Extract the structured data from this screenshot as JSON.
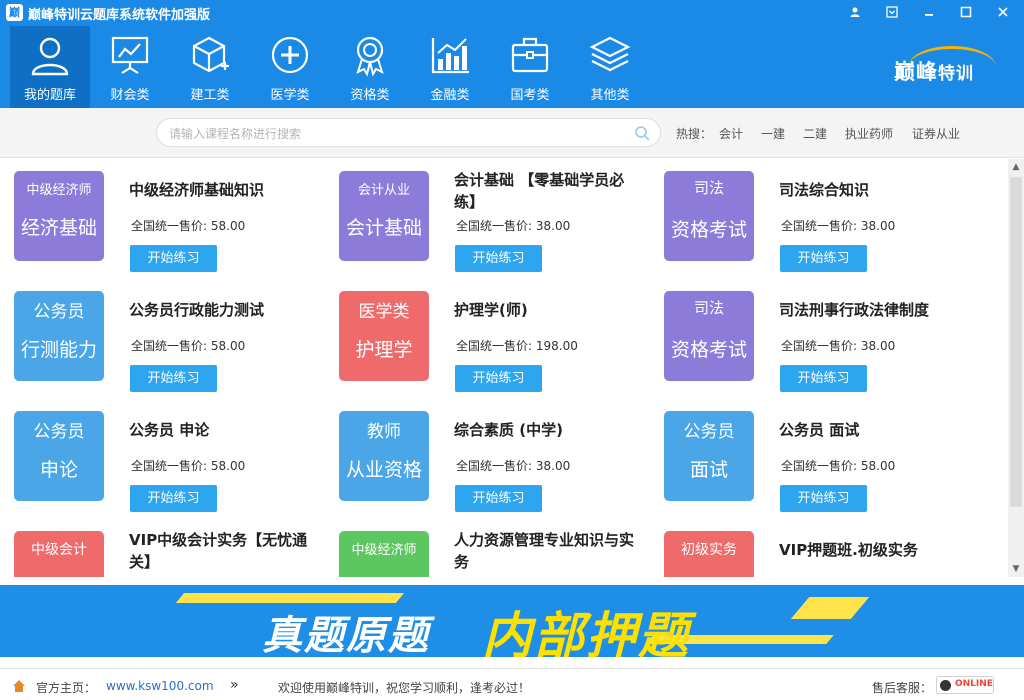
{
  "window": {
    "title": "巅峰特训云题库系统软件加强版",
    "app_icon_glyph": "巅",
    "buttons": [
      "user-icon",
      "settings-icon",
      "minimize-icon",
      "maximize-icon",
      "close-icon"
    ]
  },
  "nav": {
    "items": [
      {
        "label": "我的题库",
        "icon": "user-icon",
        "active": true
      },
      {
        "label": "财会类",
        "icon": "presentation-chart-icon"
      },
      {
        "label": "建工类",
        "icon": "cube-plus-icon"
      },
      {
        "label": "医学类",
        "icon": "medical-cross-icon"
      },
      {
        "label": "资格类",
        "icon": "award-badge-icon"
      },
      {
        "label": "金融类",
        "icon": "bar-chart-icon"
      },
      {
        "label": "国考类",
        "icon": "briefcase-icon"
      },
      {
        "label": "其他类",
        "icon": "layers-icon"
      }
    ],
    "brand": {
      "main": "巅峰",
      "sub": "特训"
    }
  },
  "search": {
    "placeholder": "请输入课程名称进行搜索",
    "hot_label": "热搜：",
    "hot_terms": [
      "会计",
      "一建",
      "二建",
      "执业药师",
      "证券从业"
    ]
  },
  "courses": [
    {
      "thumb_top": "中级经济师",
      "thumb_bottom": "经济基础",
      "color": "#8c7bd9",
      "title": "中级经济师基础知识",
      "price": "全国统一售价: 58.00",
      "button": "开始练习"
    },
    {
      "thumb_top": "会计从业",
      "thumb_bottom": "会计基础",
      "color": "#8c7bd9",
      "title": "会计基础 【零基础学员必练】",
      "price": "全国统一售价: 38.00",
      "button": "开始练习"
    },
    {
      "thumb_top": "司法",
      "thumb_bottom": "资格考试",
      "color": "#8c7bd9",
      "title": "司法综合知识",
      "price": "全国统一售价: 38.00",
      "button": "开始练习"
    },
    {
      "thumb_top": "公务员",
      "thumb_bottom": "行测能力",
      "color": "#4aa6e6",
      "title": "公务员行政能力测试",
      "price": "全国统一售价: 58.00",
      "button": "开始练习"
    },
    {
      "thumb_top": "医学类",
      "thumb_bottom": "护理学",
      "color": "#ef6b6b",
      "title": "护理学(师)",
      "price": "全国统一售价: 198.00",
      "button": "开始练习"
    },
    {
      "thumb_top": "司法",
      "thumb_bottom": "资格考试",
      "color": "#8c7bd9",
      "title": "司法刑事行政法律制度",
      "price": "全国统一售价: 38.00",
      "button": "开始练习"
    },
    {
      "thumb_top": "公务员",
      "thumb_bottom": "申论",
      "color": "#4aa6e6",
      "title": "公务员 申论",
      "price": "全国统一售价: 58.00",
      "button": "开始练习"
    },
    {
      "thumb_top": "教师",
      "thumb_bottom": "从业资格",
      "color": "#4aa6e6",
      "title": "综合素质 (中学)",
      "price": "全国统一售价: 38.00",
      "button": "开始练习"
    },
    {
      "thumb_top": "公务员",
      "thumb_bottom": "面试",
      "color": "#4aa6e6",
      "title": "公务员 面试",
      "price": "全国统一售价: 58.00",
      "button": "开始练习"
    },
    {
      "thumb_top": "中级会计",
      "thumb_bottom": "",
      "color": "#ef6b6b",
      "title": "VIP中级会计实务【无忧通关】",
      "price": "",
      "button": ""
    },
    {
      "thumb_top": "中级经济师",
      "thumb_bottom": "",
      "color": "#5cc760",
      "title": "人力资源管理专业知识与实务",
      "price": "",
      "button": ""
    },
    {
      "thumb_top": "初级实务",
      "thumb_bottom": "",
      "color": "#ef6b6b",
      "title": "VIP押题班.初级实务",
      "price": "",
      "button": ""
    }
  ],
  "banner": {
    "text_white": "真题原题",
    "text_yellow": "内部押题",
    "accent": "#ffe100",
    "background": "#1f8ee6"
  },
  "status": {
    "home_label": "官方主页：",
    "home_url": "www.ksw100.com",
    "chevrons": "»",
    "welcome": "欢迎使用巅峰特训，祝您学习顺利，逢考必过！",
    "service_label": "售后客服：",
    "qq_status": "ONLINE"
  },
  "colors": {
    "primary": "#1a8ae6",
    "nav_active": "#0e6fc4",
    "button": "#2ea5ef",
    "purple": "#8c7bd9",
    "blue": "#4aa6e6",
    "red": "#ef6b6b",
    "green": "#5cc760"
  }
}
